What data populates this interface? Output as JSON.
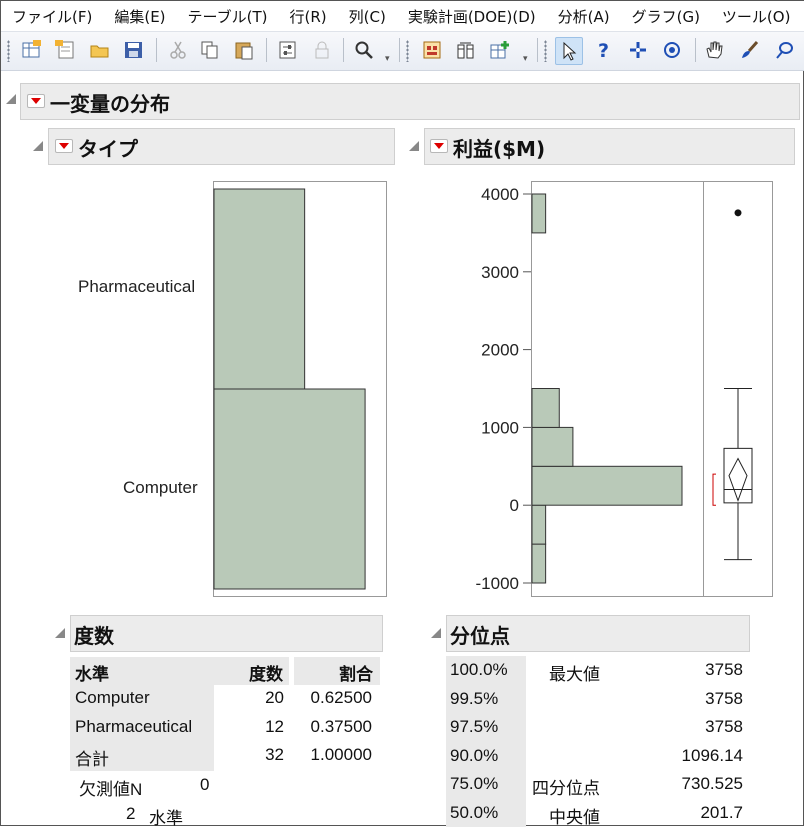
{
  "menu": [
    "ファイル(F)",
    "編集(E)",
    "テーブル(T)",
    "行(R)",
    "列(C)",
    "実験計画(DOE)(D)",
    "分析(A)",
    "グラフ(G)",
    "ツール(O)"
  ],
  "toolbar_icons": [
    "new-data-table-icon",
    "new-script-icon",
    "open-folder-icon",
    "save-icon",
    "cut-icon",
    "copy-icon",
    "paste-icon",
    "data-filter-icon",
    "lock-icon",
    "search-icon",
    "report-icon",
    "column-switch-icon",
    "add-table-icon",
    "arrow-select-icon",
    "help-icon",
    "crosshair-icon",
    "target-icon",
    "hand-icon",
    "brush-icon",
    "lasso-icon"
  ],
  "report": {
    "title": "一変量の分布",
    "type_section": {
      "title": "タイプ",
      "categories": [
        "Pharmaceutical",
        "Computer"
      ]
    },
    "profit_section": {
      "title": "利益($M)",
      "ticks": [
        "4000",
        "3000",
        "2000",
        "1000",
        "0",
        "-1000"
      ]
    },
    "freq": {
      "title": "度数",
      "headers": [
        "水準",
        "度数",
        "割合"
      ],
      "rows": [
        [
          "Computer",
          "20",
          "0.62500"
        ],
        [
          "Pharmaceutical",
          "12",
          "0.37500"
        ],
        [
          "合計",
          "32",
          "1.00000"
        ]
      ],
      "missing_label": "欠測値N",
      "missing_value": "0",
      "levels_count": "2",
      "levels_label": "水準"
    },
    "quantiles": {
      "title": "分位点",
      "rows": [
        [
          "100.0%",
          "最大値",
          "3758"
        ],
        [
          "99.5%",
          "",
          "3758"
        ],
        [
          "97.5%",
          "",
          "3758"
        ],
        [
          "90.0%",
          "",
          "1096.14"
        ],
        [
          "75.0%",
          "四分位点",
          "730.525"
        ],
        [
          "50.0%",
          "中央値",
          "201.7"
        ]
      ]
    }
  },
  "chart_data": [
    {
      "type": "bar",
      "categories": [
        "Pharmaceutical",
        "Computer"
      ],
      "values": [
        12,
        20
      ]
    },
    {
      "type": "bar",
      "categories": [
        "-1000--500",
        "-500-0",
        "0-500",
        "500-1000",
        "1000-1500",
        "3500-4000"
      ],
      "values": [
        1,
        1,
        11,
        3,
        2,
        1
      ],
      "ylim": [
        -1000,
        4000
      ],
      "box": {
        "min": -700,
        "q1": 30,
        "median": 201.7,
        "q3": 730.525,
        "whisker_high": 1500,
        "outlier": 3758
      }
    }
  ],
  "colors": {
    "bar_fill": "#b9c9b8",
    "bar_stroke": "#333333",
    "red": "#cc0000"
  }
}
